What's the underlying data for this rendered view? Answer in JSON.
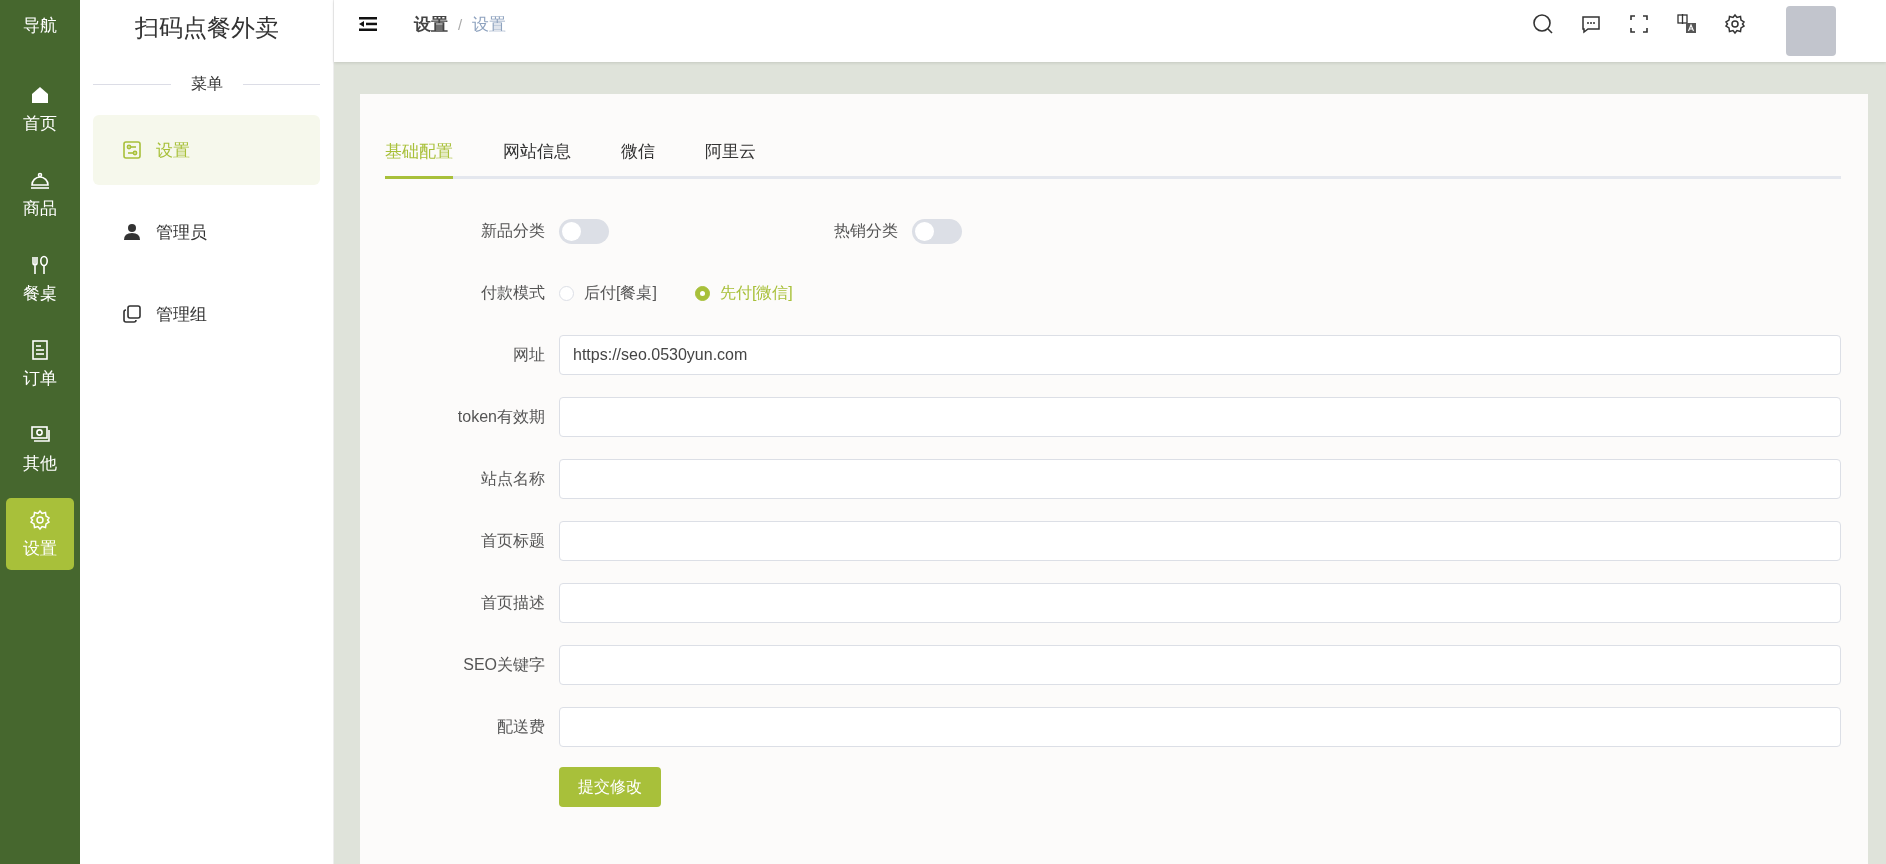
{
  "nav_rail": {
    "title": "导航",
    "items": [
      {
        "label": "首页",
        "selected": false
      },
      {
        "label": "商品",
        "selected": false
      },
      {
        "label": "餐桌",
        "selected": false
      },
      {
        "label": "订单",
        "selected": false
      },
      {
        "label": "其他",
        "selected": false
      },
      {
        "label": "设置",
        "selected": true
      }
    ]
  },
  "menu": {
    "title": "扫码点餐外卖",
    "section": "菜单",
    "items": [
      {
        "label": "设置",
        "selected": true
      },
      {
        "label": "管理员",
        "selected": false
      },
      {
        "label": "管理组",
        "selected": false
      }
    ]
  },
  "header": {
    "breadcrumb": [
      "设置",
      "设置"
    ],
    "separator": "/"
  },
  "tabs": [
    {
      "label": "基础配置",
      "selected": true
    },
    {
      "label": "网站信息",
      "selected": false
    },
    {
      "label": "微信",
      "selected": false
    },
    {
      "label": "阿里云",
      "selected": false
    }
  ],
  "form": {
    "rows": [
      {
        "kind": "toggles",
        "items": [
          {
            "label": "新品分类",
            "on": false
          },
          {
            "label": "热销分类",
            "on": false
          }
        ]
      },
      {
        "kind": "radio",
        "label": "付款模式",
        "options": [
          {
            "label": "后付[餐桌]",
            "selected": false
          },
          {
            "label": "先付[微信]",
            "selected": true
          }
        ]
      },
      {
        "kind": "input",
        "label": "网址",
        "value": "https://seo.0530yun.com"
      },
      {
        "kind": "input",
        "label": "token有效期"
      },
      {
        "kind": "input",
        "label": "站点名称"
      },
      {
        "kind": "input",
        "label": "首页标题"
      },
      {
        "kind": "input",
        "label": "首页描述"
      },
      {
        "kind": "input",
        "label": "SEO关键字"
      },
      {
        "kind": "input",
        "label": "配送费"
      }
    ],
    "submit": "提交修改"
  }
}
